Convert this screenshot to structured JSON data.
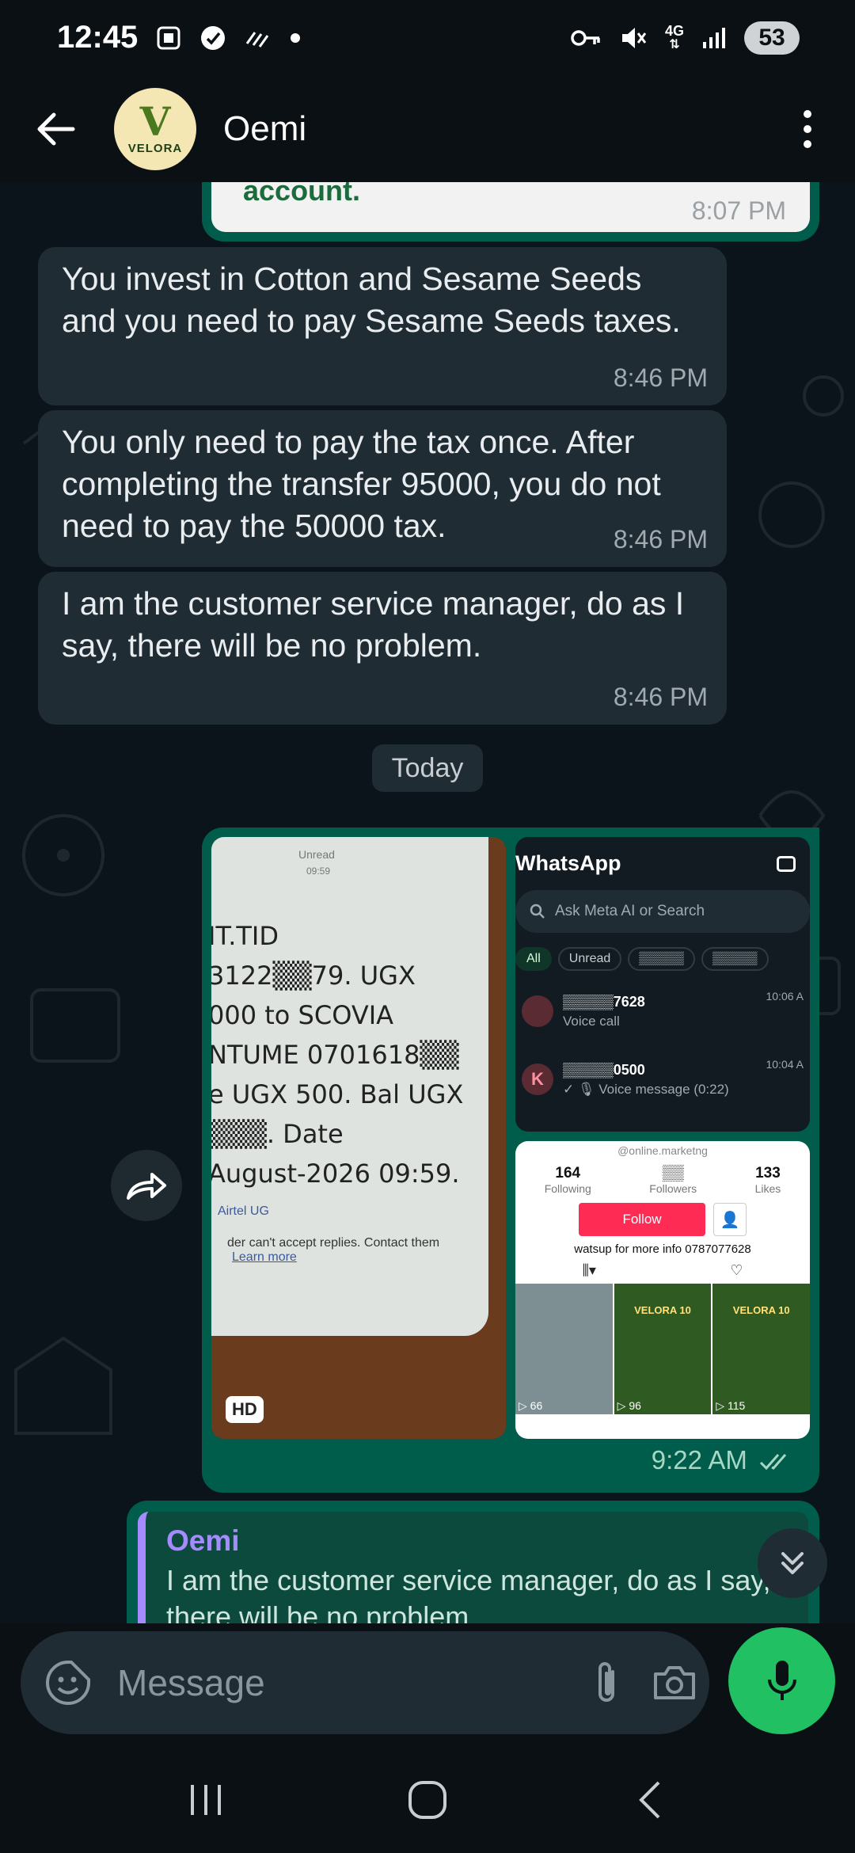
{
  "status_bar": {
    "time": "12:45",
    "network": "4G",
    "battery": "53"
  },
  "header": {
    "contact_name": "Oemi",
    "avatar_logo_text": "VELORA"
  },
  "chat": {
    "partial_top": {
      "text": "account.",
      "time": "8:07 PM"
    },
    "incoming": [
      {
        "text": "You invest in Cotton and Sesame Seeds and you need to pay Sesame Seeds taxes.",
        "time": "8:46 PM"
      },
      {
        "text": "You only need to pay the tax once. After completing the transfer 95000, you do not need to pay the 50000 tax.",
        "time": "8:46 PM"
      },
      {
        "text": "I am the customer service manager, do as I say, there will be no problem.",
        "time": "8:46 PM"
      }
    ],
    "date_divider": "Today",
    "media_message": {
      "time": "9:22 AM",
      "hd_badge": "HD",
      "sms_photo": {
        "lines": [
          "IT.TID",
          "3122▒▒79. UGX",
          "000 to SCOVIA",
          "NTUME  0701618▒▒",
          "e UGX 500. Bal UGX",
          "▒▒▒. Date",
          "August-2026 09:59."
        ],
        "top_label": "Unread",
        "top_time": "09:59",
        "sender": "Airtel UG",
        "footer": "der can't accept replies. Contact them",
        "footer_link": "Learn more"
      },
      "whatsapp_shot": {
        "title": "WhatsApp",
        "search_placeholder": "Ask Meta AI or Search",
        "chips": [
          "All",
          "Unread",
          "▒▒▒▒▒",
          "▒▒▒▒▒"
        ],
        "chats": [
          {
            "name": "▒▒▒▒▒7628",
            "sub": "Voice call",
            "time": "10:06 A",
            "initial": ""
          },
          {
            "name": "▒▒▒▒▒0500",
            "sub": "✓ 🎙 Voice message (0:22)",
            "time": "10:04 A",
            "initial": "K"
          }
        ]
      },
      "tiktok_shot": {
        "handle": "@online.marketng",
        "stats": [
          {
            "num": "164",
            "label": "Following"
          },
          {
            "num": "▒▒",
            "label": "Followers"
          },
          {
            "num": "133",
            "label": "Likes"
          }
        ],
        "follow_label": "Follow",
        "bio": "watsup for more info 0787077628",
        "thumbs": [
          {
            "kind": "bus",
            "views": "▷ 66",
            "title": ""
          },
          {
            "kind": "poster",
            "views": "▷ 96",
            "title": "VELORA 10"
          },
          {
            "kind": "poster",
            "views": "▷ 115",
            "title": "VELORA 10"
          }
        ]
      }
    },
    "reply_message": {
      "quoted_name": "Oemi",
      "quoted_text": "I am the customer service manager, do as I say, there will be no problem."
    }
  },
  "composer": {
    "placeholder": "Message"
  },
  "colors": {
    "outgoing_bubble": "#005c4b",
    "incoming_bubble": "#202c33",
    "accent_green": "#21c063",
    "quote_accent": "#a68bff"
  }
}
